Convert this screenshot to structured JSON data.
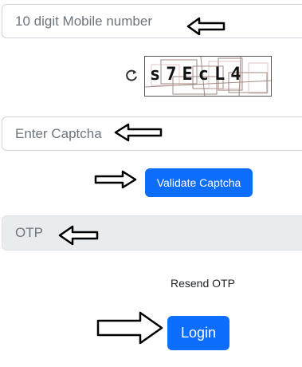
{
  "form": {
    "mobile_placeholder": "10 digit Mobile number",
    "captcha_text": "s7EcL4",
    "captcha_placeholder": "Enter Captcha",
    "validate_label": "Validate Captcha",
    "otp_placeholder": "OTP",
    "resend_label": "Resend OTP",
    "login_label": "Login"
  },
  "icons": {
    "refresh": "refresh-icon",
    "arrow": "hand-drawn-arrow-icon"
  },
  "colors": {
    "primary": "#0d6efd",
    "disabled_bg": "#e9ecef",
    "placeholder": "#6c757d"
  }
}
